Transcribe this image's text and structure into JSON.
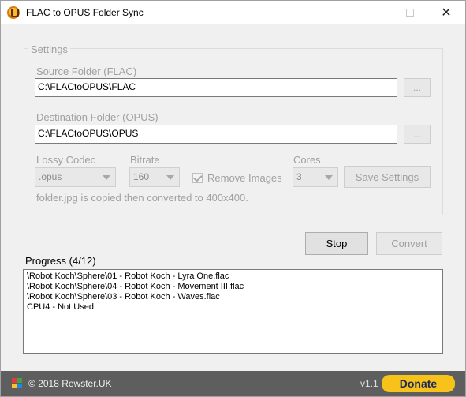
{
  "window": {
    "title": "FLAC to OPUS Folder Sync",
    "min_icon": "minimize-icon",
    "max_icon": "maximize-icon",
    "close_glyph": "✕"
  },
  "settings": {
    "legend": "Settings",
    "source_label": "Source Folder (FLAC)",
    "source_value": "C:\\FLACtoOPUS\\FLAC",
    "source_browse": "...",
    "dest_label": "Destination Folder (OPUS)",
    "dest_value": "C:\\FLACtoOPUS\\OPUS",
    "dest_browse": "...",
    "codec_label": "Lossy Codec",
    "codec_value": ".opus",
    "bitrate_label": "Bitrate",
    "bitrate_value": "160",
    "remove_images_label": "Remove Images",
    "remove_images_checked": true,
    "cores_label": "Cores",
    "cores_value": "3",
    "save_label": "Save Settings",
    "note": "folder.jpg is copied then converted to 400x400."
  },
  "actions": {
    "stop_label": "Stop",
    "convert_label": "Convert"
  },
  "progress": {
    "label": "Progress (4/12)",
    "lines": [
      "\\Robot Koch\\Sphere\\01 - Robot Koch - Lyra One.flac",
      "\\Robot Koch\\Sphere\\04 - Robot Koch - Movement III.flac",
      "\\Robot Koch\\Sphere\\03 - Robot Koch - Waves.flac",
      "CPU4 - Not Used"
    ]
  },
  "statusbar": {
    "icon": "windows-logo-icon",
    "copyright": "© 2018 Rewster.UK",
    "version": "v1.1",
    "donate_label": "Donate",
    "donate_color": "#f7c21a"
  }
}
